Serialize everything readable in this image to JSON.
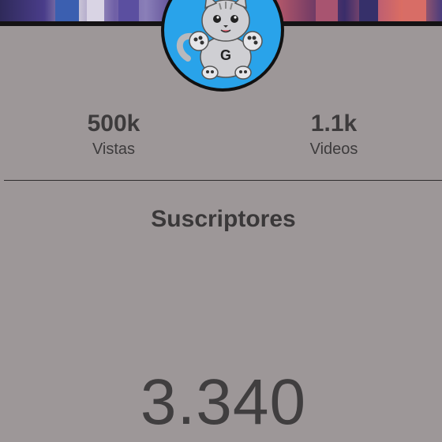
{
  "channel": {
    "avatar_icon": "cat-mascot-avatar",
    "avatar_letter": "G",
    "avatar_bg": "#29a3ea"
  },
  "stats": {
    "views_value": "500k",
    "views_label": "Vistas",
    "videos_value": "1.1k",
    "videos_label": "Videos"
  },
  "subscribers": {
    "title": "Suscriptores",
    "count": "3.340"
  },
  "colors": {
    "background": "#9d9798",
    "text": "#3d3b3c"
  }
}
